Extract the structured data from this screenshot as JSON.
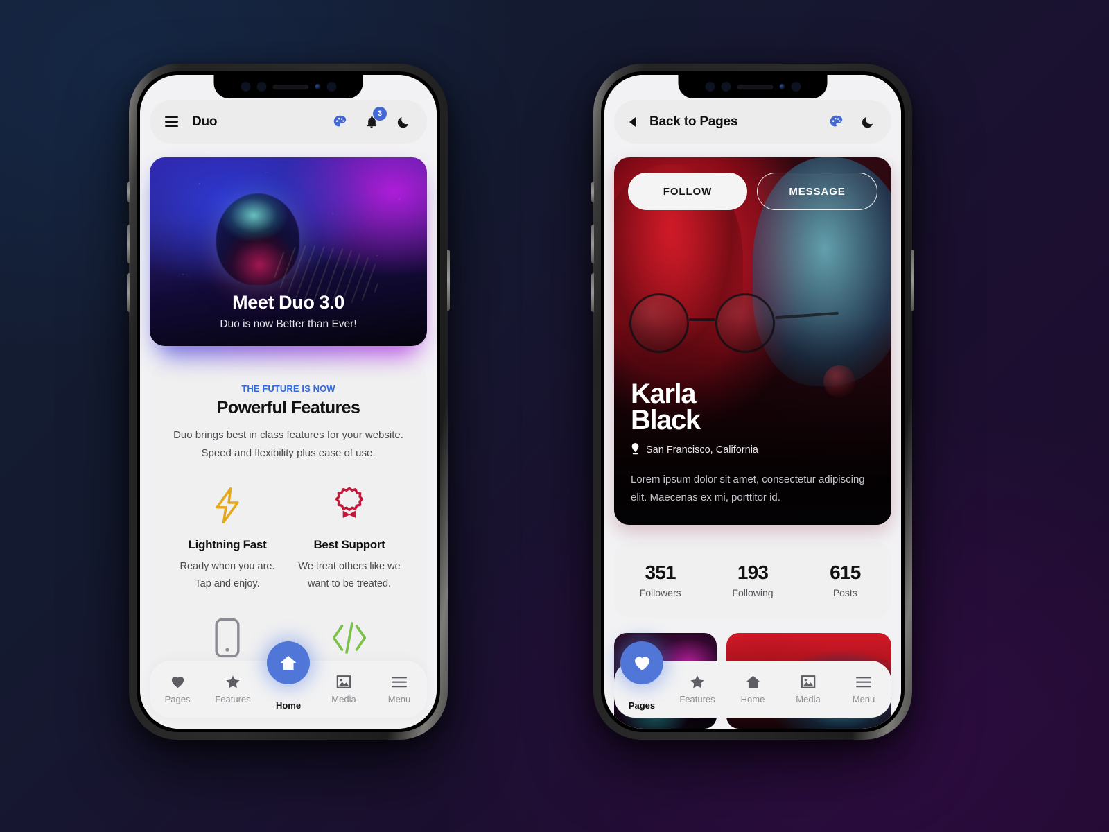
{
  "background": {
    "top_left_color": "#142036",
    "bottom_right_color": "#1f0a2e"
  },
  "accent": {
    "blue": "#4268d3",
    "link_blue": "#2f6ae2",
    "bolt_gold": "#e3a81c",
    "award_red": "#c2183a",
    "code_green": "#7cc24a"
  },
  "phone1": {
    "appbar": {
      "menu_icon": "hamburger-icon",
      "title": "Duo",
      "palette_icon": "palette-icon",
      "bell_icon": "bell-icon",
      "badge_count": "3",
      "moon_icon": "moon-icon"
    },
    "hero": {
      "title": "Meet Duo 3.0",
      "subtitle": "Duo is now Better than Ever!",
      "image_alt": "jellyfish-artwork"
    },
    "features": {
      "kicker": "THE FUTURE IS NOW",
      "heading": "Powerful Features",
      "paragraph": "Duo brings best in class features for your website. Speed and flexibility plus ease of use.",
      "items": [
        {
          "icon": "lightning-bolt-icon",
          "name": "Lightning Fast",
          "desc": "Ready when you are. Tap and enjoy."
        },
        {
          "icon": "award-badge-icon",
          "name": "Best Support",
          "desc": "We treat others like we want to be treated."
        },
        {
          "icon": "mobile-phone-icon",
          "name": "",
          "desc": ""
        },
        {
          "icon": "code-brackets-icon",
          "name": "",
          "desc": ""
        }
      ]
    },
    "nav": {
      "items": [
        {
          "label": "Pages",
          "icon": "heart-icon",
          "active": false
        },
        {
          "label": "Features",
          "icon": "star-icon",
          "active": false
        },
        {
          "label": "Home",
          "icon": "home-icon",
          "active": true
        },
        {
          "label": "Media",
          "icon": "image-icon",
          "active": false
        },
        {
          "label": "Menu",
          "icon": "hamburger-icon",
          "active": false
        }
      ]
    }
  },
  "phone2": {
    "appbar": {
      "back_icon": "back-arrow-icon",
      "title": "Back to Pages",
      "palette_icon": "palette-icon",
      "moon_icon": "moon-icon"
    },
    "profile": {
      "follow_label": "FOLLOW",
      "message_label": "MESSAGE",
      "name_line1": "Karla",
      "name_line2": "Black",
      "location_icon": "location-pin-icon",
      "location": "San Francisco, California",
      "bio": "Lorem ipsum dolor sit amet, consectetur adipiscing elit. Maecenas ex mi, porttitor id.",
      "photo_alt": "portrait-red-blue-lighting"
    },
    "stats": [
      {
        "value": "351",
        "label": "Followers"
      },
      {
        "value": "193",
        "label": "Following"
      },
      {
        "value": "615",
        "label": "Posts"
      }
    ],
    "gallery": [
      {
        "alt": "thumbnail-neon-dark"
      },
      {
        "alt": "thumbnail-red-portrait"
      }
    ],
    "nav": {
      "items": [
        {
          "label": "Pages",
          "icon": "heart-icon",
          "active": true
        },
        {
          "label": "Features",
          "icon": "star-icon",
          "active": false
        },
        {
          "label": "Home",
          "icon": "home-icon",
          "active": false
        },
        {
          "label": "Media",
          "icon": "image-icon",
          "active": false
        },
        {
          "label": "Menu",
          "icon": "hamburger-icon",
          "active": false
        }
      ]
    }
  }
}
